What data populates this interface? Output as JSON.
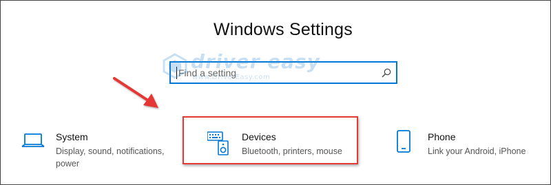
{
  "window": {
    "title": "Windows Settings"
  },
  "search": {
    "placeholder": "Find a setting",
    "icon": "search-icon"
  },
  "watermark": {
    "brand": "driver easy",
    "url": "www.DriverEasy.com"
  },
  "colors": {
    "accent": "#0078d7",
    "highlight": "#e53935",
    "arrow": "#e53935"
  },
  "tiles": [
    {
      "name": "System",
      "description": "Display, sound, notifications, power",
      "icon": "laptop-icon"
    },
    {
      "name": "Devices",
      "description": "Bluetooth, printers, mouse",
      "icon": "devices-icon"
    },
    {
      "name": "Phone",
      "description": "Link your Android, iPhone",
      "icon": "phone-icon"
    }
  ]
}
